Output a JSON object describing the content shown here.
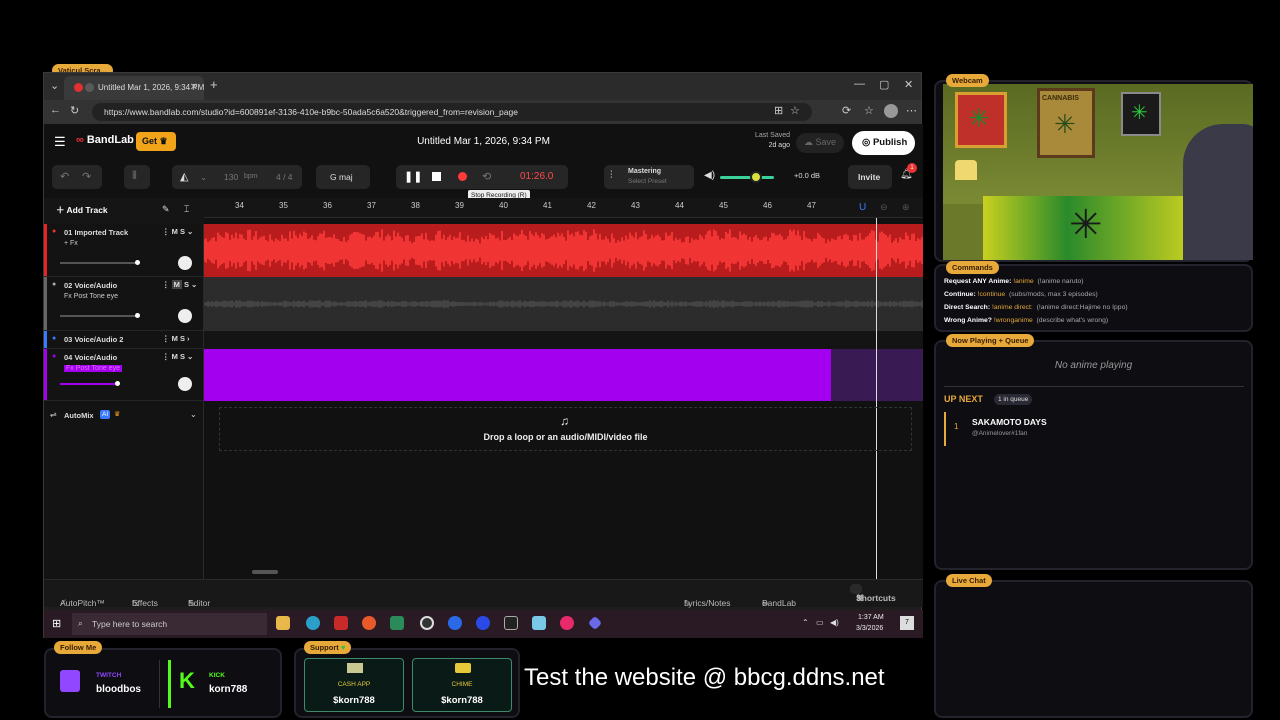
{
  "browser": {
    "tab_title": "Untitled Mar 1, 2026, 9:34 PM",
    "url": "https://www.bandlab.com/studio?id=600891ef-3136-410e-b9bc-50ada5c6a520&triggered_from=revision_page",
    "floating_label": "Vaticul Scra..."
  },
  "app": {
    "logo": "BandLab",
    "get_label": "Get",
    "title": "Untitled Mar 1, 2026, 9:34 PM",
    "last_saved_label": "Last Saved",
    "last_saved_value": "2d ago",
    "save_label": "Save",
    "publish_label": "Publish",
    "bpm": "130",
    "bpm_unit": "bpm",
    "time_sig": "4 / 4",
    "key": "G maj",
    "time": "01:26.0",
    "tooltip": "Stop Recording (R)",
    "mastering": "Mastering",
    "mastering_sub": "Select Preset",
    "volume_db": "+0.0 dB",
    "invite": "Invite",
    "notif_count": "1",
    "add_track": "Add Track",
    "ruler": [
      "34",
      "35",
      "36",
      "37",
      "38",
      "39",
      "40",
      "41",
      "42",
      "43",
      "44",
      "45",
      "46",
      "47"
    ],
    "tracks": [
      {
        "num": "01",
        "name": "Imported Track",
        "fx": "+ Fx",
        "m": "M",
        "s": "S"
      },
      {
        "num": "02",
        "name": "Voice/Audio",
        "fx": "Fx Post Tone eye",
        "m": "M",
        "s": "S"
      },
      {
        "num": "03",
        "name": "Voice/Audio 2",
        "fx": "",
        "m": "M",
        "s": "S"
      },
      {
        "num": "04",
        "name": "Voice/Audio",
        "fx": "Fx Post Tone eye",
        "m": "M",
        "s": "S"
      }
    ],
    "automix": "AutoMix",
    "ai_badge": "AI",
    "drop_text": "Drop a loop or an audio/MIDI/video file",
    "footer": {
      "autopitch": "AutoPitch™",
      "effects": "Effects",
      "editor": "Editor",
      "lyrics": "Lyrics/Notes",
      "sounds": "BandLab Sounds",
      "shortcuts": "Shortcuts"
    }
  },
  "taskbar": {
    "search_placeholder": "Type here to search",
    "time": "1:37 AM",
    "date": "3/3/2026",
    "badge": "7"
  },
  "overlay": {
    "webcam_tag": "Webcam",
    "webcam_sign": "CANNABIS",
    "commands_tag": "Commands",
    "commands": [
      {
        "label": "Request ANY Anime:",
        "cmd": "!anime",
        "hint": "(!anime naruto)"
      },
      {
        "label": "Continue:",
        "cmd": "!continue",
        "hint": "(subs/mods, max 3 episodes)"
      },
      {
        "label": "Direct Search:",
        "cmd": "!anime direct:",
        "hint": "(!anime direct:Hajime no Ippo)"
      },
      {
        "label": "Wrong Anime?",
        "cmd": "!wronganime",
        "hint": "(describe what's wrong)"
      }
    ],
    "now_playing_tag": "Now Playing + Queue",
    "no_anime": "No anime playing",
    "up_next": "UP NEXT",
    "queue_count": "1 in queue",
    "queue": [
      {
        "index": "1",
        "title": "SAKAMOTO DAYS",
        "user": "@Animelover#1fan"
      }
    ],
    "live_chat_tag": "Live Chat",
    "follow_tag": "Follow Me",
    "twitch_label": "TWITCH",
    "twitch_user": "bloodbos",
    "kick_label": "KICK",
    "kick_user": "korn788",
    "support_tag": "Support",
    "cashapp_label": "CASH APP",
    "cashapp_user": "$korn788",
    "chime_label": "CHIME",
    "chime_user": "$korn788",
    "website_text": "Test the website @ bbcg.ddns.net"
  },
  "colors": {
    "track1": "#e52424",
    "track4": "#a400f0",
    "accent": "#e6a93a",
    "time_red": "#ff4a4a"
  }
}
